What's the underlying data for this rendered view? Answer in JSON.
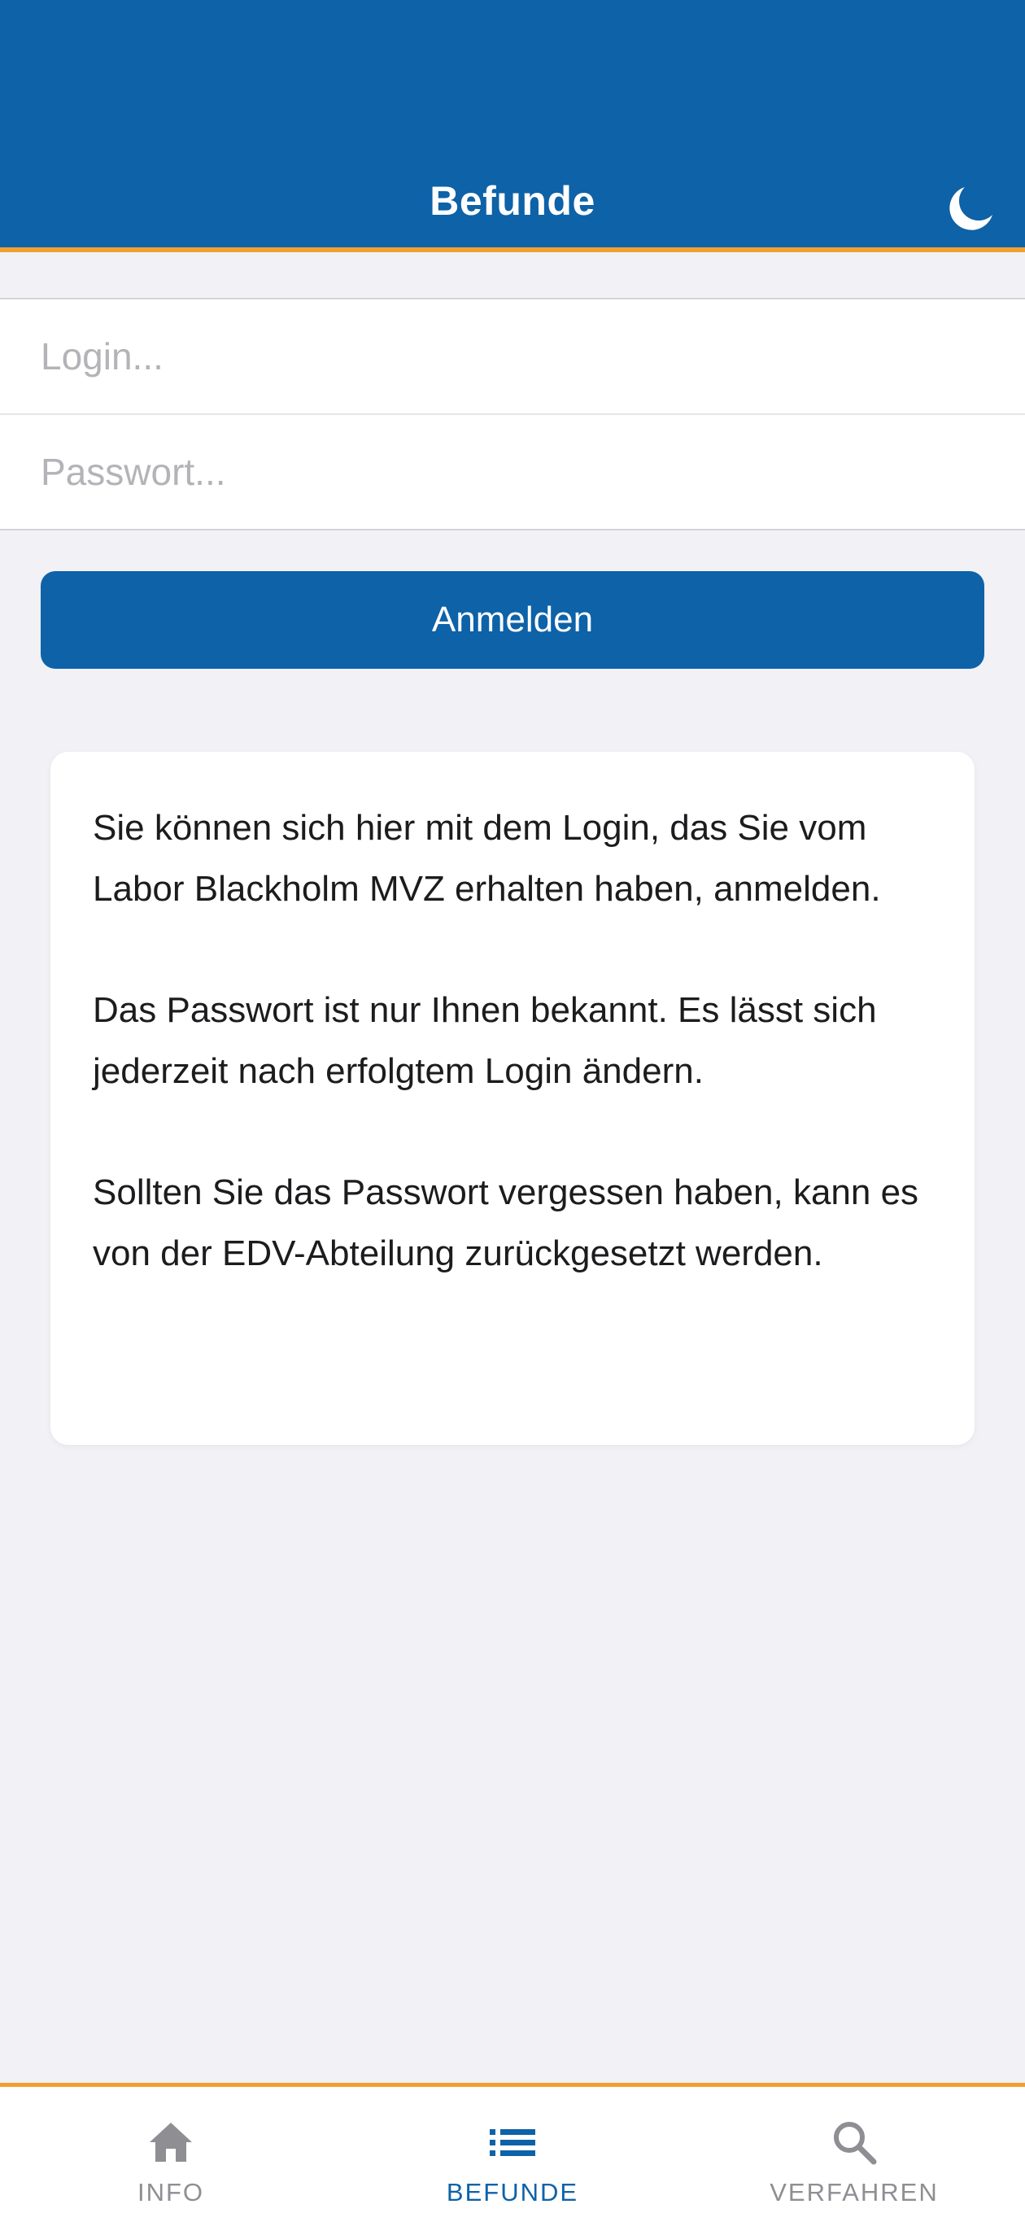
{
  "header": {
    "title": "Befunde",
    "dark_mode_icon": "moon-icon"
  },
  "form": {
    "login_placeholder": "Login...",
    "login_value": "",
    "password_placeholder": "Passwort...",
    "password_value": ""
  },
  "login_button": {
    "label": "Anmelden"
  },
  "info_card": {
    "paragraphs": [
      "Sie können sich hier mit dem Login, das Sie vom Labor Blackholm MVZ erhalten haben, anmelden.",
      "Das Passwort ist nur Ihnen bekannt. Es lässt sich jederzeit nach erfolgtem Login ändern.",
      "Sollten Sie das Passwort vergessen haben, kann es von der EDV-Abteilung zurückgesetzt werden."
    ]
  },
  "tabbar": {
    "items": [
      {
        "label": "INFO",
        "icon": "home-icon",
        "active": false
      },
      {
        "label": "BEFUNDE",
        "icon": "list-icon",
        "active": true
      },
      {
        "label": "VERFAHREN",
        "icon": "search-icon",
        "active": false
      }
    ]
  },
  "colors": {
    "primary": "#0d62a8",
    "accent": "#f0a030",
    "background": "#f1f1f6",
    "inactive_tab": "#8e8e93"
  }
}
